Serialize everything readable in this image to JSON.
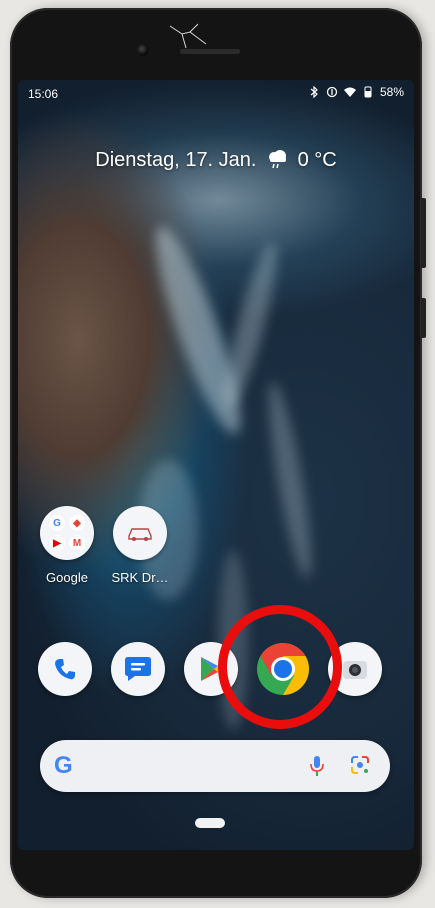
{
  "status_bar": {
    "time": "15:06",
    "battery": "58%",
    "icons": [
      "bluetooth-icon",
      "data-saver-icon",
      "wifi-icon",
      "battery-icon"
    ]
  },
  "at_a_glance": {
    "date": "Dienstag, 17. Jan.",
    "weather_icon": "cloud-rain-icon",
    "temperature": "0 °C"
  },
  "home_apps": [
    {
      "label": "Google",
      "icon": "google-apps-folder-icon"
    },
    {
      "label": "SRK Dr…",
      "icon": "car-icon"
    }
  ],
  "dock": [
    {
      "icon": "phone-icon"
    },
    {
      "icon": "messages-icon"
    },
    {
      "icon": "play-store-icon"
    },
    {
      "icon": "chrome-icon",
      "highlighted": true
    },
    {
      "icon": "camera-icon"
    }
  ],
  "search_bar": {
    "logo": "G",
    "mic_icon": "mic-icon",
    "lens_icon": "lens-icon"
  },
  "colors": {
    "highlight_ring": "#ea0d0d",
    "google_blue": "#4285f4",
    "google_red": "#ea4335",
    "google_yellow": "#fbbc05",
    "google_green": "#34a853"
  }
}
